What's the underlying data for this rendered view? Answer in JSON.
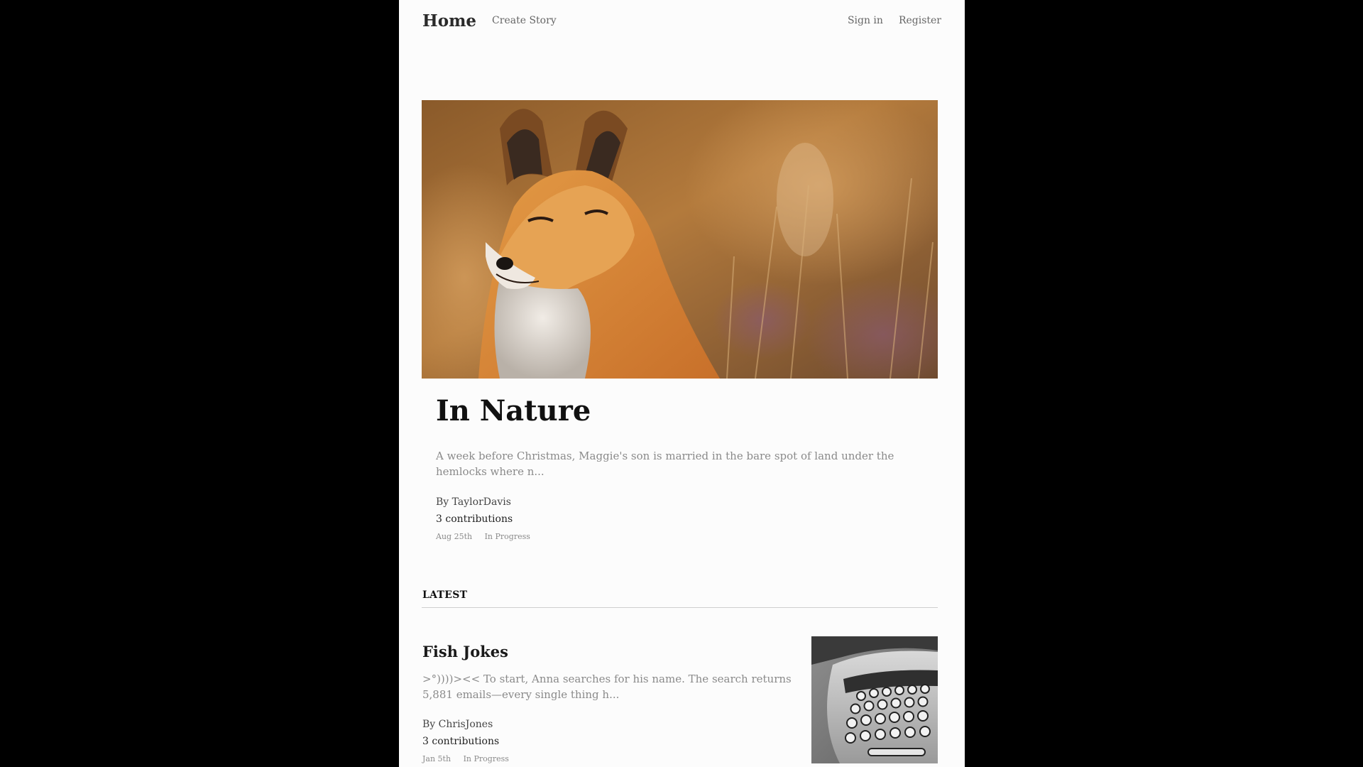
{
  "nav": {
    "brand": "Home",
    "create_story": "Create Story",
    "sign_in": "Sign in",
    "register": "Register"
  },
  "featured": {
    "image": "fox-in-grass",
    "title": "In Nature",
    "excerpt": "A week before Christmas, Maggie's son is married in the bare spot of land under the hemlocks where n...",
    "author_prefix": "By",
    "author": "TaylorDavis",
    "contributions": "3 contributions",
    "date": "Aug 25th",
    "status": "In Progress"
  },
  "latest": {
    "label": "LATEST",
    "stories": [
      {
        "title": "Fish Jokes",
        "excerpt": ">°))))><< To start, Anna searches for his name. The search returns 5,881 emails—every single thing h...",
        "author_prefix": "By",
        "author": "ChrisJones",
        "contributions": "3 contributions",
        "date": "Jan 5th",
        "status": "In Progress",
        "image": "typewriter"
      }
    ]
  },
  "colors": {
    "page_background": "#fcfcfc",
    "outer_background": "#000000",
    "muted_text": "#8a8a8a"
  }
}
